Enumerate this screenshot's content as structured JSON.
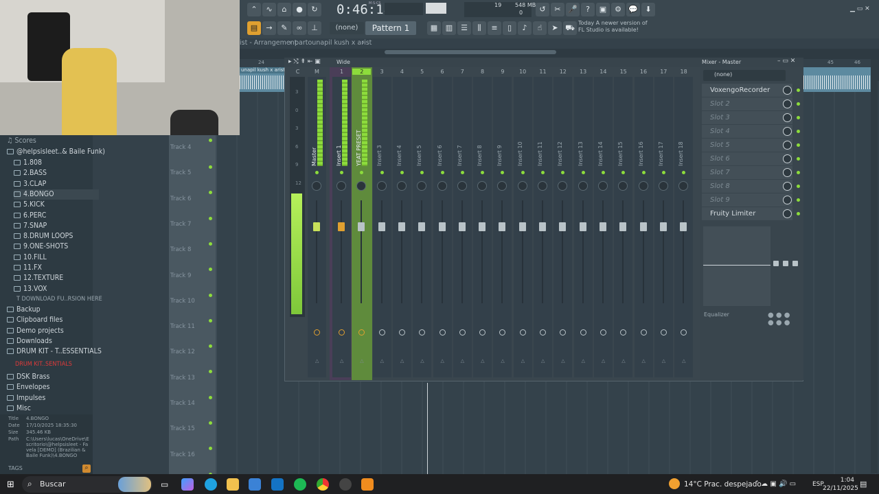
{
  "toolbar": {
    "time": "0:46:18",
    "time_suffix": "M:S:CS",
    "cpu": "19",
    "mem": "548 MB",
    "mem2": "0",
    "pattern": "Pattern 1",
    "none": "(none)",
    "news_line1": "Today  A newer version of",
    "news_line2": "FL Studio is available!"
  },
  "breadcrumb": {
    "text": "ist - Arrangement",
    "sep": "›",
    "song": "partounapil kush x arist",
    "more": "›"
  },
  "playlist_clip": "unapil kush x arist",
  "bar_numbers": {
    "b24": "24",
    "b45": "45",
    "b46": "46"
  },
  "browser": {
    "scores": "Scores",
    "root": "@helpsisleet..& Baile Funk)",
    "items": [
      "1.808",
      "2.BASS",
      "3.CLAP",
      "4.BONGO",
      "5.KICK",
      "6.PERC",
      "7.SNAP",
      "8.DRUM LOOPS",
      "9.ONE-SHOTS",
      "10.FILL",
      "11.FX",
      "12.TEXTURE",
      "13.VOX"
    ],
    "download": "DOWNLOAD FU..RSION HERE",
    "folders": [
      "Backup",
      "Clipboard files",
      "Demo projects",
      "Downloads",
      "DRUM KIT - T..ESSENTIALS"
    ],
    "drumkit_red": "DRUM KIT..SENTIALS",
    "folders2": [
      "DSK Brass",
      "Envelopes",
      "Impulses",
      "Misc"
    ],
    "tags": "TAGS"
  },
  "info": {
    "title_label": "Title",
    "title": "4.BONGO",
    "date_label": "Date",
    "date": "17/10/2025 18:35:30",
    "size_label": "Size",
    "size": "345.46 KB",
    "path_label": "Path",
    "path": "C:\\Users\\lucas\\OneDrive\\Escritorio\\@helpsisleet - Favela [DEMO] (Brazilian & Baile Funk)\\4.BONGO"
  },
  "tracks": [
    "Track 4",
    "Track 5",
    "Track 6",
    "Track 7",
    "Track 8",
    "Track 9",
    "Track 10",
    "Track 11",
    "Track 12",
    "Track 13",
    "Track 14",
    "Track 15",
    "Track 16"
  ],
  "mixer": {
    "title": "Mixer - Master",
    "view": "Wide",
    "preset": "(none)",
    "channels": [
      {
        "num": "C",
        "name": ""
      },
      {
        "num": "M",
        "name": "Master"
      },
      {
        "num": "1",
        "name": "Insert 1"
      },
      {
        "num": "2",
        "name": "YEAT PRESET"
      },
      {
        "num": "3",
        "name": "Insert 3"
      },
      {
        "num": "4",
        "name": "Insert 4"
      },
      {
        "num": "5",
        "name": "Insert 5"
      },
      {
        "num": "6",
        "name": "Insert 6"
      },
      {
        "num": "7",
        "name": "Insert 7"
      },
      {
        "num": "8",
        "name": "Insert 8"
      },
      {
        "num": "9",
        "name": "Insert 9"
      },
      {
        "num": "10",
        "name": "Insert 10"
      },
      {
        "num": "11",
        "name": "Insert 11"
      },
      {
        "num": "12",
        "name": "Insert 12"
      },
      {
        "num": "13",
        "name": "Insert 13"
      },
      {
        "num": "14",
        "name": "Insert 14"
      },
      {
        "num": "15",
        "name": "Insert 15"
      },
      {
        "num": "16",
        "name": "Insert 16"
      },
      {
        "num": "17",
        "name": "Insert 17"
      },
      {
        "num": "18",
        "name": "Insert 18"
      }
    ],
    "meter_scale": [
      "3",
      "0",
      "3",
      "6",
      "9",
      "12"
    ],
    "slots": [
      "VoxengoRecorder",
      "Slot 2",
      "Slot 3",
      "Slot 4",
      "Slot 5",
      "Slot 6",
      "Slot 7",
      "Slot 8",
      "Slot 9",
      "Fruity Limiter"
    ],
    "equalizer": "Equalizer"
  },
  "taskbar": {
    "search": "Buscar",
    "weather": "14°C  Prac. despejado",
    "lang": "ESP",
    "time": "1:04",
    "date": "22/11/2025"
  },
  "colors": {
    "accent": "#8ddc3c",
    "mixer_bg": "#3a464e",
    "taskbar": "#1f2022"
  }
}
